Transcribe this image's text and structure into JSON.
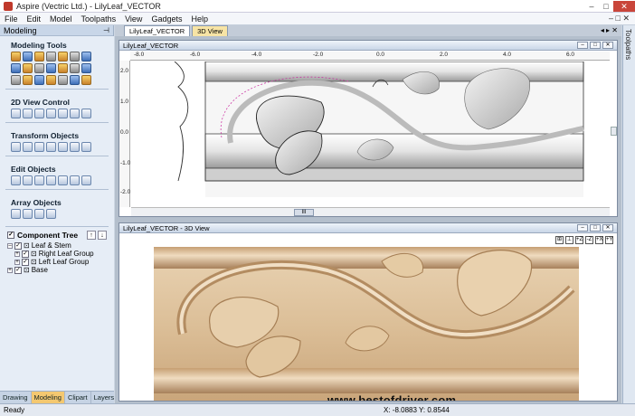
{
  "window": {
    "title": "Aspire (Vectric Ltd.) - LilyLeaf_VECTOR",
    "minimize": "–",
    "maximize": "□",
    "close": "✕"
  },
  "menu": {
    "items": [
      "File",
      "Edit",
      "Model",
      "Toolpaths",
      "View",
      "Gadgets",
      "Help"
    ],
    "right_controls": "– □ ✕"
  },
  "left_panel": {
    "header": "Modeling",
    "pin": "⊣",
    "sections": {
      "modeling_tools": "Modeling Tools",
      "view_control": "2D View Control",
      "transform": "Transform Objects",
      "edit": "Edit Objects",
      "array": "Array Objects"
    },
    "component_tree": {
      "title": "Component Tree",
      "up": "↑",
      "down": "↓",
      "items": [
        {
          "label": "Leaf & Stem",
          "level": 0
        },
        {
          "label": "Right Leaf Group",
          "level": 1
        },
        {
          "label": "Left Leaf Group",
          "level": 1
        },
        {
          "label": "Base",
          "level": 0
        }
      ]
    },
    "tabs": [
      "Drawing",
      "Modeling",
      "Clipart",
      "Layers"
    ],
    "active_tab": "Modeling"
  },
  "doc_tabs": {
    "items": [
      "LilyLeaf_VECTOR",
      "3D View"
    ],
    "active": "3D View",
    "nav": "◂ ▸ ✕"
  },
  "view2d": {
    "title": "LilyLeaf_VECTOR",
    "ruler_ticks": [
      "-8.0",
      "-6.0",
      "-4.0",
      "-2.0",
      "0.0",
      "2.0",
      "4.0",
      "6.0"
    ],
    "vruler_ticks": [
      "2.0",
      "1.0",
      "0.0",
      "-1.0",
      "-2.0"
    ],
    "scroll_thumb": "III"
  },
  "view3d": {
    "title": "LilyLeaf_VECTOR - 3D View",
    "toolbar": [
      "⊞",
      "⊥",
      "+Z",
      "-Z",
      "+X",
      "+Y"
    ]
  },
  "right_strip": {
    "label": "Toolpaths"
  },
  "watermark": "www.bestofdriver.com",
  "status": {
    "ready": "Ready",
    "coords": "X: -8.0883 Y: 0.8544"
  }
}
